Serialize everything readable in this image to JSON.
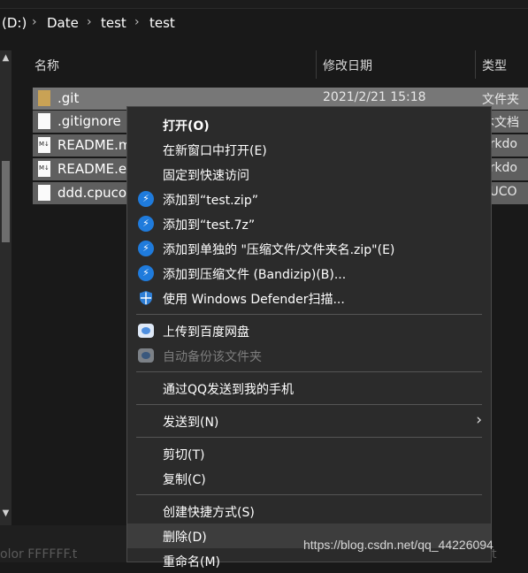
{
  "address_bar": {
    "crumbs": [
      "(D:)",
      "Date",
      "test",
      "test"
    ],
    "separator": "›"
  },
  "columns": {
    "name": "名称",
    "date_modified": "修改日期",
    "type": "类型"
  },
  "files": [
    {
      "name": ".git",
      "date": "2021/2/21 15:18",
      "type": "文件夹",
      "icon": "folder-icon",
      "state": "selected"
    },
    {
      "name": ".gitignore",
      "date": "",
      "type": "本文档",
      "icon": "text-file-icon",
      "state": "selected-dim"
    },
    {
      "name": "README.m",
      "date": "",
      "type": "arkdo",
      "icon": "markdown-file-icon",
      "state": "selected-dim"
    },
    {
      "name": "README.e",
      "date": "",
      "type": "arkdo",
      "icon": "markdown-file-icon",
      "state": "selected-dim"
    },
    {
      "name": "ddd.cpuco",
      "date": "",
      "type": "PUCO",
      "icon": "text-file-icon",
      "state": "selected-dim"
    }
  ],
  "context_menu": {
    "items": [
      {
        "label": "打开(O)",
        "bold": true
      },
      {
        "label": "在新窗口中打开(E)"
      },
      {
        "label": "固定到快速访问"
      },
      {
        "label": "添加到“test.zip”",
        "icon": "bandizip-icon"
      },
      {
        "label": "添加到“test.7z”",
        "icon": "bandizip-icon"
      },
      {
        "label": "添加到单独的 \"压缩文件/文件夹名.zip\"(E)",
        "icon": "bandizip-icon"
      },
      {
        "label": "添加到压缩文件 (Bandizip)(B)...",
        "icon": "bandizip-icon"
      },
      {
        "label": "使用 Windows Defender扫描...",
        "icon": "defender-shield-icon"
      },
      {
        "label": "上传到百度网盘",
        "icon": "baidu-netdisk-icon"
      },
      {
        "label": "自动备份该文件夹",
        "icon": "baidu-netdisk-icon",
        "disabled": true
      },
      {
        "label": "通过QQ发送到我的手机"
      },
      {
        "label": "发送到(N)",
        "submenu": true
      },
      {
        "label": "剪切(T)"
      },
      {
        "label": "复制(C)"
      },
      {
        "label": "创建快捷方式(S)"
      },
      {
        "label": "删除(D)",
        "hover": true
      },
      {
        "label": "重命名(M)"
      }
    ],
    "submenu_arrow": "›"
  },
  "bottom": {
    "partial_left": "olor FFFFFF.t",
    "partial_right": "t"
  },
  "watermark": "https://blog.csdn.net/qq_44226094",
  "colors": {
    "background": "#191919",
    "menu_background": "#2b2b2b",
    "selected_row": "#777777",
    "bandizip_blue": "#1f7bdc",
    "folder": "#c9a255"
  }
}
